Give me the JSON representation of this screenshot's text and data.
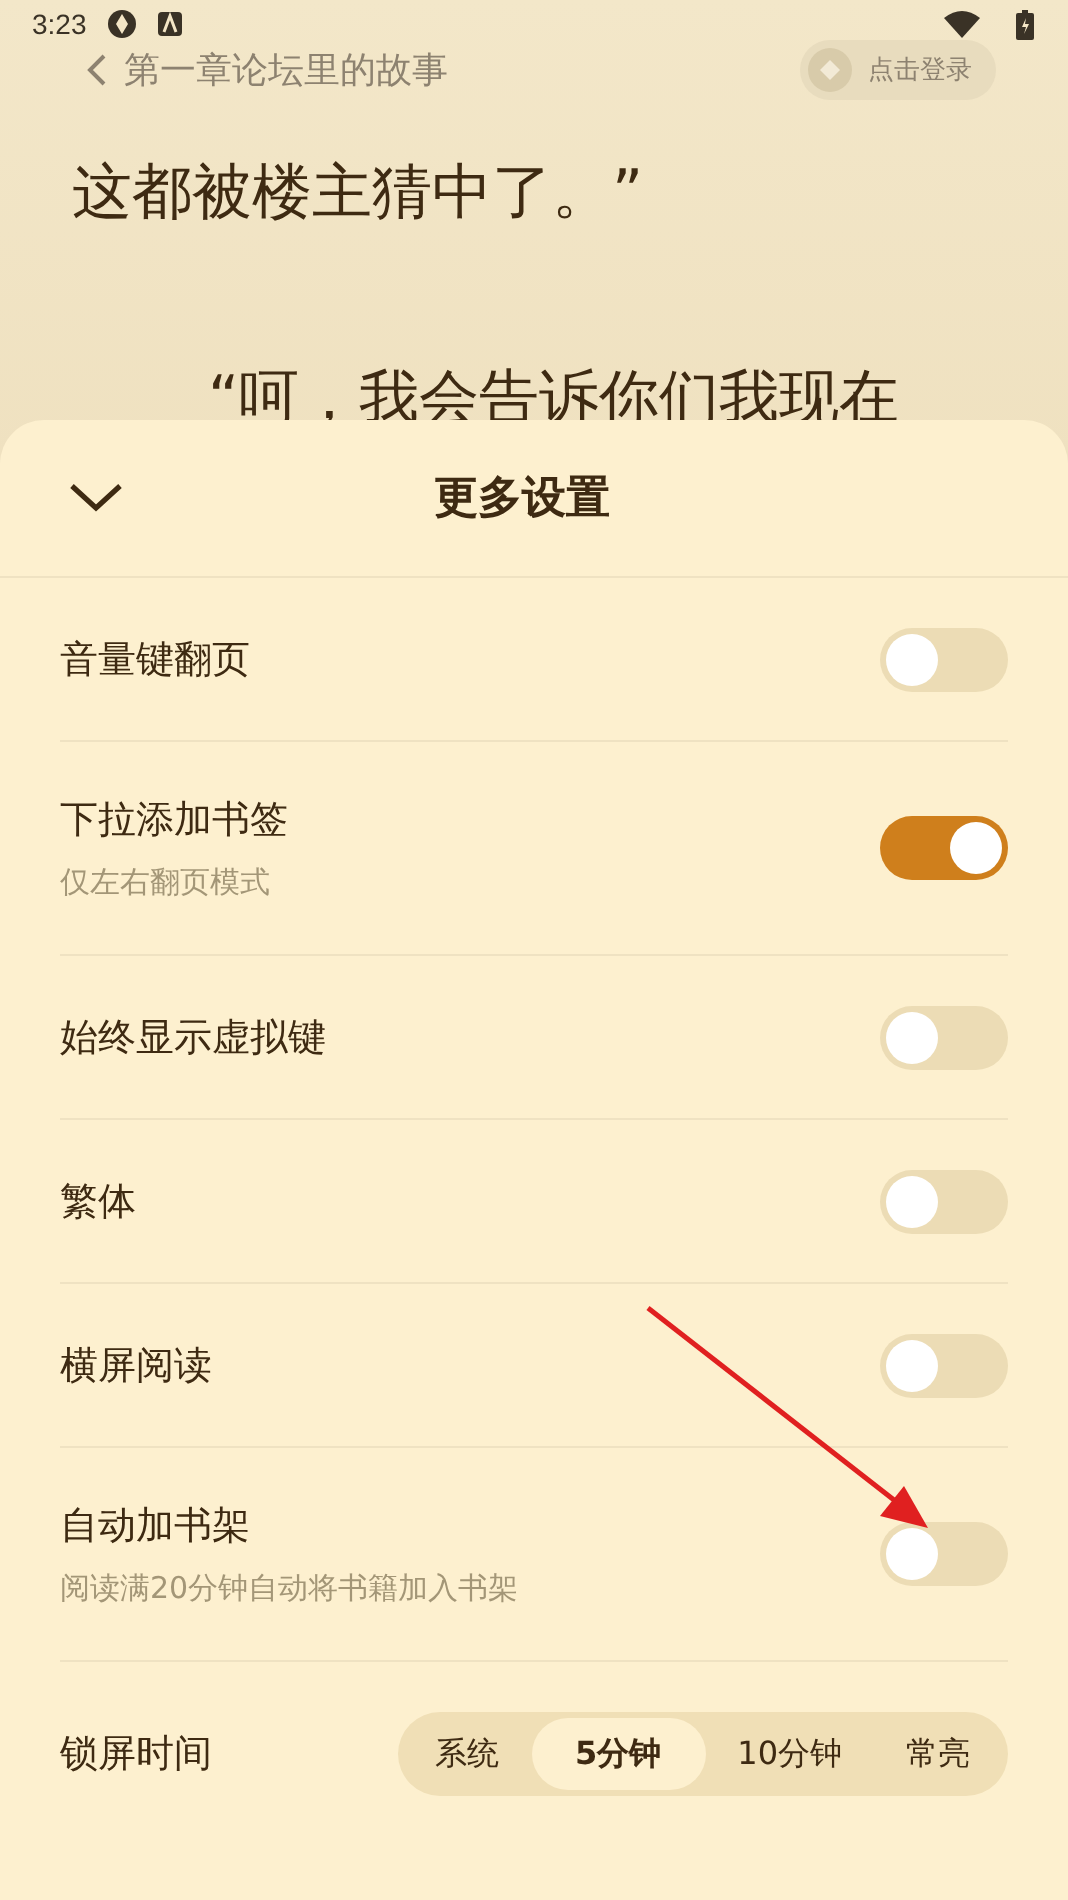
{
  "status_bar": {
    "time": "3:23"
  },
  "reader": {
    "chapter_title": "第一章论坛里的故事",
    "login_button": "点击登录",
    "lines": [
      "这都被楼主猜中了。”",
      "“呵，我会告诉你们我现在"
    ]
  },
  "sheet": {
    "title": "更多设置",
    "settings": [
      {
        "kind": "toggle",
        "label": "音量键翻页",
        "on": false
      },
      {
        "kind": "toggle",
        "label": "下拉添加书签",
        "hint": "仅左右翻页模式",
        "on": true
      },
      {
        "kind": "toggle",
        "label": "始终显示虚拟键",
        "on": false
      },
      {
        "kind": "toggle",
        "label": "繁体",
        "on": false
      },
      {
        "kind": "toggle",
        "label": "横屏阅读",
        "on": false
      },
      {
        "kind": "toggle",
        "label": "自动加书架",
        "hint": "阅读满20分钟自动将书籍加入书架",
        "on": false
      },
      {
        "kind": "segmented",
        "label": "锁屏时间",
        "options": [
          {
            "label": "系统",
            "selected": false
          },
          {
            "label": "5分钟",
            "selected": true
          },
          {
            "label": "10分钟",
            "selected": false
          },
          {
            "label": "常亮",
            "selected": false
          }
        ]
      }
    ]
  }
}
